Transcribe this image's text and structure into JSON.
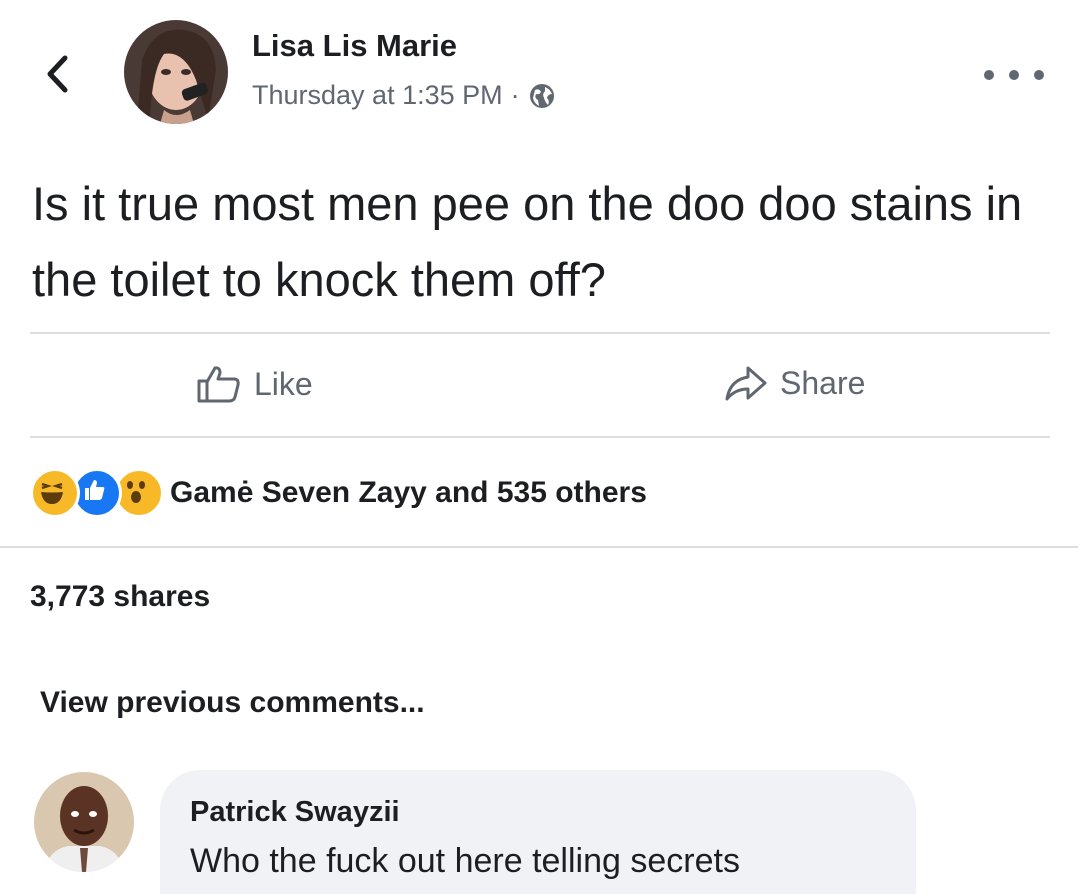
{
  "post": {
    "author": "Lisa Lis Marie",
    "timestamp": "Thursday at 1:35 PM",
    "separator": "·",
    "privacy_icon": "globe-icon",
    "text": "Is it true most men pee on the doo doo stains in the toilet to knock them off?"
  },
  "actions": {
    "like_label": "Like",
    "share_label": "Share"
  },
  "reactions": {
    "icons": [
      "haha-icon",
      "like-icon",
      "wow-icon"
    ],
    "summary": "Gamė Seven Zayy and 535 others"
  },
  "shares": "3,773 shares",
  "comments": {
    "view_previous": "View previous comments...",
    "items": [
      {
        "author": "Patrick Swayzii",
        "text": "Who the fuck out here telling secrets"
      }
    ]
  },
  "colors": {
    "text": "#1c1e21",
    "muted": "#606770",
    "divider": "#dadde1",
    "bubble": "#f0f2f5",
    "like_blue": "#1877f2",
    "reaction_yellow": "#f7b928"
  }
}
